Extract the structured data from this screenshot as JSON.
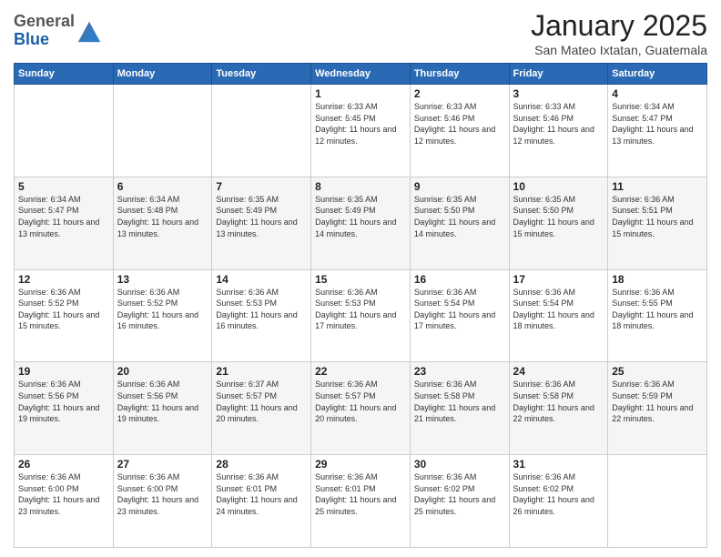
{
  "header": {
    "logo_general": "General",
    "logo_blue": "Blue",
    "month_title": "January 2025",
    "location": "San Mateo Ixtatan, Guatemala"
  },
  "days_of_week": [
    "Sunday",
    "Monday",
    "Tuesday",
    "Wednesday",
    "Thursday",
    "Friday",
    "Saturday"
  ],
  "weeks": [
    [
      {
        "day": "",
        "info": ""
      },
      {
        "day": "",
        "info": ""
      },
      {
        "day": "",
        "info": ""
      },
      {
        "day": "1",
        "info": "Sunrise: 6:33 AM\nSunset: 5:45 PM\nDaylight: 11 hours and 12 minutes."
      },
      {
        "day": "2",
        "info": "Sunrise: 6:33 AM\nSunset: 5:46 PM\nDaylight: 11 hours and 12 minutes."
      },
      {
        "day": "3",
        "info": "Sunrise: 6:33 AM\nSunset: 5:46 PM\nDaylight: 11 hours and 12 minutes."
      },
      {
        "day": "4",
        "info": "Sunrise: 6:34 AM\nSunset: 5:47 PM\nDaylight: 11 hours and 13 minutes."
      }
    ],
    [
      {
        "day": "5",
        "info": "Sunrise: 6:34 AM\nSunset: 5:47 PM\nDaylight: 11 hours and 13 minutes."
      },
      {
        "day": "6",
        "info": "Sunrise: 6:34 AM\nSunset: 5:48 PM\nDaylight: 11 hours and 13 minutes."
      },
      {
        "day": "7",
        "info": "Sunrise: 6:35 AM\nSunset: 5:49 PM\nDaylight: 11 hours and 13 minutes."
      },
      {
        "day": "8",
        "info": "Sunrise: 6:35 AM\nSunset: 5:49 PM\nDaylight: 11 hours and 14 minutes."
      },
      {
        "day": "9",
        "info": "Sunrise: 6:35 AM\nSunset: 5:50 PM\nDaylight: 11 hours and 14 minutes."
      },
      {
        "day": "10",
        "info": "Sunrise: 6:35 AM\nSunset: 5:50 PM\nDaylight: 11 hours and 15 minutes."
      },
      {
        "day": "11",
        "info": "Sunrise: 6:36 AM\nSunset: 5:51 PM\nDaylight: 11 hours and 15 minutes."
      }
    ],
    [
      {
        "day": "12",
        "info": "Sunrise: 6:36 AM\nSunset: 5:52 PM\nDaylight: 11 hours and 15 minutes."
      },
      {
        "day": "13",
        "info": "Sunrise: 6:36 AM\nSunset: 5:52 PM\nDaylight: 11 hours and 16 minutes."
      },
      {
        "day": "14",
        "info": "Sunrise: 6:36 AM\nSunset: 5:53 PM\nDaylight: 11 hours and 16 minutes."
      },
      {
        "day": "15",
        "info": "Sunrise: 6:36 AM\nSunset: 5:53 PM\nDaylight: 11 hours and 17 minutes."
      },
      {
        "day": "16",
        "info": "Sunrise: 6:36 AM\nSunset: 5:54 PM\nDaylight: 11 hours and 17 minutes."
      },
      {
        "day": "17",
        "info": "Sunrise: 6:36 AM\nSunset: 5:54 PM\nDaylight: 11 hours and 18 minutes."
      },
      {
        "day": "18",
        "info": "Sunrise: 6:36 AM\nSunset: 5:55 PM\nDaylight: 11 hours and 18 minutes."
      }
    ],
    [
      {
        "day": "19",
        "info": "Sunrise: 6:36 AM\nSunset: 5:56 PM\nDaylight: 11 hours and 19 minutes."
      },
      {
        "day": "20",
        "info": "Sunrise: 6:36 AM\nSunset: 5:56 PM\nDaylight: 11 hours and 19 minutes."
      },
      {
        "day": "21",
        "info": "Sunrise: 6:37 AM\nSunset: 5:57 PM\nDaylight: 11 hours and 20 minutes."
      },
      {
        "day": "22",
        "info": "Sunrise: 6:36 AM\nSunset: 5:57 PM\nDaylight: 11 hours and 20 minutes."
      },
      {
        "day": "23",
        "info": "Sunrise: 6:36 AM\nSunset: 5:58 PM\nDaylight: 11 hours and 21 minutes."
      },
      {
        "day": "24",
        "info": "Sunrise: 6:36 AM\nSunset: 5:58 PM\nDaylight: 11 hours and 22 minutes."
      },
      {
        "day": "25",
        "info": "Sunrise: 6:36 AM\nSunset: 5:59 PM\nDaylight: 11 hours and 22 minutes."
      }
    ],
    [
      {
        "day": "26",
        "info": "Sunrise: 6:36 AM\nSunset: 6:00 PM\nDaylight: 11 hours and 23 minutes."
      },
      {
        "day": "27",
        "info": "Sunrise: 6:36 AM\nSunset: 6:00 PM\nDaylight: 11 hours and 23 minutes."
      },
      {
        "day": "28",
        "info": "Sunrise: 6:36 AM\nSunset: 6:01 PM\nDaylight: 11 hours and 24 minutes."
      },
      {
        "day": "29",
        "info": "Sunrise: 6:36 AM\nSunset: 6:01 PM\nDaylight: 11 hours and 25 minutes."
      },
      {
        "day": "30",
        "info": "Sunrise: 6:36 AM\nSunset: 6:02 PM\nDaylight: 11 hours and 25 minutes."
      },
      {
        "day": "31",
        "info": "Sunrise: 6:36 AM\nSunset: 6:02 PM\nDaylight: 11 hours and 26 minutes."
      },
      {
        "day": "",
        "info": ""
      }
    ]
  ]
}
